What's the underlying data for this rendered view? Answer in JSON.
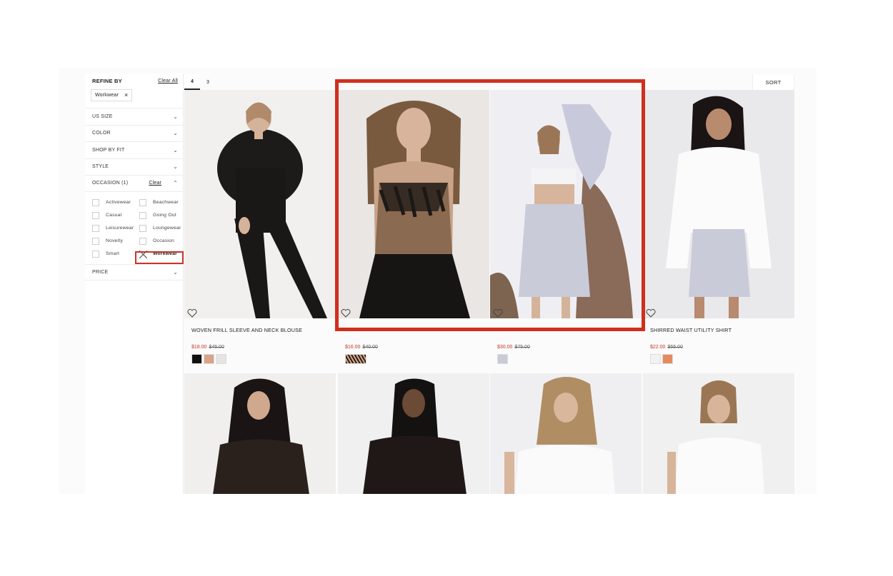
{
  "sidebar": {
    "refine_title": "REFINE BY",
    "clear_all": "Clear All",
    "active_chip": "Workwear",
    "facets": [
      "US SIZE",
      "COLOR",
      "SHOP BY FIT",
      "STYLE"
    ],
    "occasion": {
      "title": "OCCASION (1)",
      "clear": "Clear",
      "options": [
        {
          "label": "Activewear",
          "checked": false
        },
        {
          "label": "Beachwear",
          "checked": false
        },
        {
          "label": "Casual",
          "checked": false
        },
        {
          "label": "Going Out",
          "checked": false
        },
        {
          "label": "Leisurewear",
          "checked": false
        },
        {
          "label": "Loungewear",
          "checked": false
        },
        {
          "label": "Novelty",
          "checked": false
        },
        {
          "label": "Occasion",
          "checked": false
        },
        {
          "label": "Smart",
          "checked": false
        },
        {
          "label": "Workwear",
          "checked": true
        }
      ]
    },
    "price_facet": "PRICE"
  },
  "toolbar": {
    "view_4": "4",
    "view_3": "3",
    "sort": "SORT"
  },
  "products": [
    {
      "name": "WOVEN FRILL SLEEVE AND NECK BLOUSE",
      "price": "$18.00",
      "was": "$45.00",
      "swatches": [
        "#111111",
        "#d9a389",
        "#e4e4e4"
      ]
    },
    {
      "name": "",
      "price": "$16.00",
      "was": "$40.00",
      "swatches": [
        "zebra"
      ]
    },
    {
      "name": "",
      "price": "$30.00",
      "was": "$75.00",
      "swatches": [
        "#c9cbd9"
      ]
    },
    {
      "name": "SHIRRED WAIST UTILITY SHIRT",
      "price": "$22.00",
      "was": "$55.00",
      "swatches": [
        "#f2f2f2",
        "#e58a5c"
      ]
    }
  ],
  "colors": {
    "accent_red": "#c4362b",
    "selection_frame": "#d12f1e",
    "sale_price": "#c4362b"
  },
  "icons": {
    "heart": "heart-icon",
    "chevron": "chevron-down-icon",
    "close": "close-icon"
  }
}
